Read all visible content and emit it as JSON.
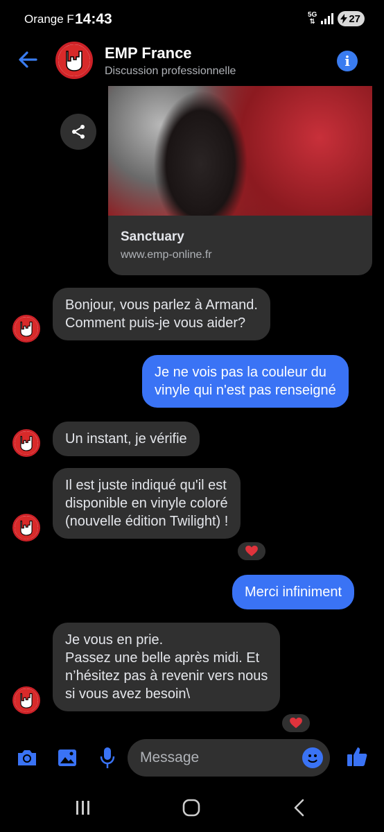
{
  "status_bar": {
    "carrier": "Orange F",
    "time": "14:43",
    "network": "5G",
    "battery": "27"
  },
  "header": {
    "title": "EMP France",
    "subtitle": "Discussion professionnelle"
  },
  "link_preview": {
    "title": "Sanctuary",
    "url": "www.emp-online.fr"
  },
  "messages": [
    {
      "direction": "incoming",
      "text": "Bonjour, vous parlez à Armand.\nComment puis-je vous aider?"
    },
    {
      "direction": "outgoing",
      "text": "Je ne vois pas la couleur du\nvinyle qui n'est pas renseigné"
    },
    {
      "direction": "incoming",
      "text": "Un instant, je vérifie"
    },
    {
      "direction": "incoming",
      "text": "Il est juste indiqué qu'il est\ndisponible en vinyle coloré\n(nouvelle édition Twilight) !",
      "reaction": "heart"
    },
    {
      "direction": "outgoing",
      "text": "Merci infiniment"
    },
    {
      "direction": "incoming",
      "text": "Je vous en prie.\nPassez une belle après midi. Et\nn’hésitez pas à revenir vers nous\nsi vous avez besoin\\",
      "reaction": "heart"
    }
  ],
  "composer": {
    "placeholder": "Message"
  },
  "colors": {
    "accent": "#3a73f5",
    "incoming_bubble": "#303030",
    "brand_red": "#cc2127",
    "reaction_heart": "#e0333c"
  },
  "icons": [
    "back-arrow-icon",
    "info-icon",
    "share-icon",
    "camera-icon",
    "image-icon",
    "microphone-icon",
    "emoji-icon",
    "thumbs-up-icon",
    "heart-icon",
    "recents-icon",
    "home-icon",
    "back-icon"
  ]
}
